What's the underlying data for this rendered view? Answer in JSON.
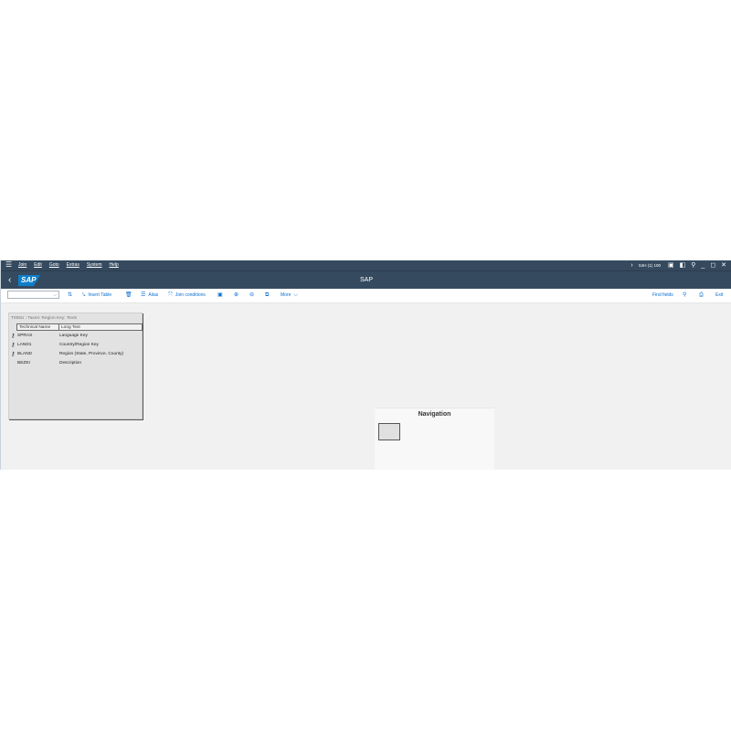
{
  "menubar": {
    "menus": [
      "Join",
      "Edit",
      "Goto",
      "Extras",
      "System",
      "Help"
    ],
    "system_info": "S4H (1) 100"
  },
  "shell": {
    "logo": "SAP",
    "title": "SAP"
  },
  "toolbar": {
    "combo_value": "",
    "insert_table": "Insert Table",
    "alias": "Alias",
    "join_conditions": "Join conditions",
    "more": "More",
    "find_fields": "Find fields",
    "exit": "Exit"
  },
  "table": {
    "title": "T005U : Taxes: Region Key: Texts",
    "columns": [
      "Technical Name",
      "Long Text"
    ],
    "rows": [
      {
        "key": true,
        "name": "SPRAS",
        "text": "Language Key"
      },
      {
        "key": true,
        "name": "LAND1",
        "text": "Country/Region Key"
      },
      {
        "key": true,
        "name": "BLAND",
        "text": "Region (State, Province, County)"
      },
      {
        "key": false,
        "name": "BEZEI",
        "text": "Description"
      }
    ]
  },
  "navigation": {
    "title": "Navigation"
  },
  "icons": {
    "key": "key-icon"
  },
  "colors": {
    "shell": "#354a5f",
    "accent": "#0a6ed1"
  }
}
